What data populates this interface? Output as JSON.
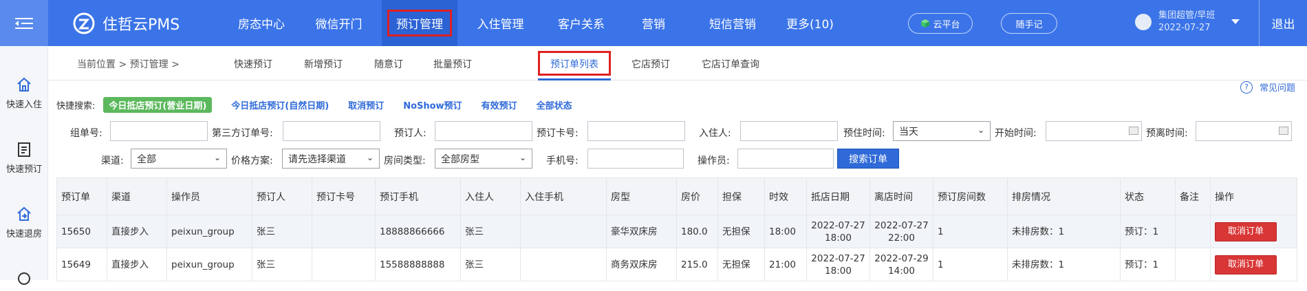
{
  "header": {
    "app_name": "住哲云PMS",
    "nav": [
      {
        "label": "房态中心",
        "active": false
      },
      {
        "label": "微信开门",
        "active": false
      },
      {
        "label": "预订管理",
        "active": true
      },
      {
        "label": "入住管理",
        "active": false
      },
      {
        "label": "客户关系",
        "active": false
      },
      {
        "label": "营销",
        "active": false
      },
      {
        "label": "短信营销",
        "active": false
      },
      {
        "label": "更多(10)",
        "active": false
      }
    ],
    "cloud_button": "云平台",
    "note_button": "随手记",
    "user_name": "集团超管/早班",
    "user_date": "2022-07-27",
    "logout": "退出"
  },
  "sidebar": {
    "items": [
      {
        "label": "快速入住",
        "icon": "home-icon"
      },
      {
        "label": "快速预订",
        "icon": "clipboard-icon"
      },
      {
        "label": "快速退房",
        "icon": "checkout-icon"
      },
      {
        "label": "",
        "icon": "search-icon"
      }
    ]
  },
  "subnav": {
    "breadcrumb": "当前位置 > 预订管理 >",
    "tabs": [
      {
        "label": "快速预订",
        "active": false
      },
      {
        "label": "新增预订",
        "active": false
      },
      {
        "label": "随意订",
        "active": false
      },
      {
        "label": "批量预订",
        "active": false
      },
      {
        "label": "预订单列表",
        "active": true
      },
      {
        "label": "它店预订",
        "active": false
      },
      {
        "label": "它店订单查询",
        "active": false
      }
    ],
    "help": "常见问题"
  },
  "quick_search": {
    "label": "快捷搜索:",
    "active": "今日抵店预订(营业日期)",
    "links": [
      "今日抵店预订(自然日期)",
      "取消预订",
      "NoShow预订",
      "有效预订",
      "全部状态"
    ]
  },
  "filters": {
    "group_no": {
      "label": "组单号:",
      "value": ""
    },
    "third_party_no": {
      "label": "第三方订单号:",
      "value": ""
    },
    "booker": {
      "label": "预订人:",
      "value": ""
    },
    "booking_card": {
      "label": "预订卡号:",
      "value": ""
    },
    "guest": {
      "label": "入住人:",
      "value": ""
    },
    "arrival_time": {
      "label": "预住时间:",
      "value": "当天"
    },
    "start_time": {
      "label": "开始时间:",
      "value": ""
    },
    "departure_time": {
      "label": "预离时间:",
      "value": ""
    },
    "channel": {
      "label": "渠道:",
      "value": "全部"
    },
    "price_plan": {
      "label": "价格方案:",
      "value": "请先选择渠道"
    },
    "room_type": {
      "label": "房间类型:",
      "value": "全部房型"
    },
    "phone": {
      "label": "手机号:",
      "value": ""
    },
    "operator": {
      "label": "操作员:",
      "value": ""
    },
    "search_button": "搜索订单"
  },
  "table": {
    "columns": [
      "预订单",
      "渠道",
      "操作员",
      "预订人",
      "预订卡号",
      "预订手机",
      "入住人",
      "入住手机",
      "房型",
      "房价",
      "担保",
      "时效",
      "抵店日期",
      "离店时间",
      "预订房间数",
      "排房情况",
      "状态",
      "备注",
      "操作"
    ],
    "rows": [
      {
        "order": "15650",
        "channel": "直接步入",
        "operator": "peixun_group",
        "booker": "张三",
        "card": "",
        "phone": "18888866666",
        "guest": "张三",
        "guest_phone": "",
        "room_type": "豪华双床房",
        "price": "180.0",
        "guarantee": "无担保",
        "timeout": "18:00",
        "arrive_date": "2022-07-27",
        "arrive_time": "18:00",
        "leave_date": "2022-07-27",
        "leave_time": "22:00",
        "rooms": "1",
        "assign": "未排房数：1",
        "status": "预订：1",
        "remark": "",
        "action": "取消订单"
      },
      {
        "order": "15649",
        "channel": "直接步入",
        "operator": "peixun_group",
        "booker": "张三",
        "card": "",
        "phone": "15588888888",
        "guest": "张三",
        "guest_phone": "",
        "room_type": "商务双床房",
        "price": "215.0",
        "guarantee": "无担保",
        "timeout": "21:00",
        "arrive_date": "2022-07-27",
        "arrive_time": "18:00",
        "leave_date": "2022-07-29",
        "leave_time": "14:00",
        "rooms": "1",
        "assign": "未排房数：1",
        "status": "预订：1",
        "remark": "",
        "action": "取消订单"
      }
    ]
  },
  "colors": {
    "primary": "#3b74e8",
    "nav_active": "#2b62d4",
    "highlight_border": "#e02020",
    "quick_green": "#5cb85c",
    "cancel_red": "#d93636"
  }
}
